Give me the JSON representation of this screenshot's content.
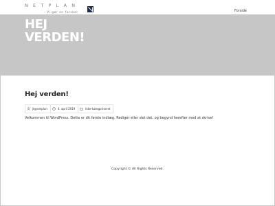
{
  "site": {
    "logo_word": "NETPLAN",
    "tagline": "- Vi gør en forskel",
    "nav": [
      "Forside"
    ]
  },
  "hero": {
    "title": "HEJ VERDEN!"
  },
  "post": {
    "title": "Hej verden!",
    "author": "jt@netplan",
    "date": "4. april 2019",
    "category": "Ikke-kategoriseret",
    "body": "Velkommen til WordPress. Dette er dit første indlæg. Redigér eller slet det, og begynd herefter med at skrive!"
  },
  "footer": {
    "text": "Copyright © All Rights Reserved."
  },
  "colors": {
    "hero_bg": "#c6c6c6",
    "logo_mark": "#1e2a4a"
  }
}
